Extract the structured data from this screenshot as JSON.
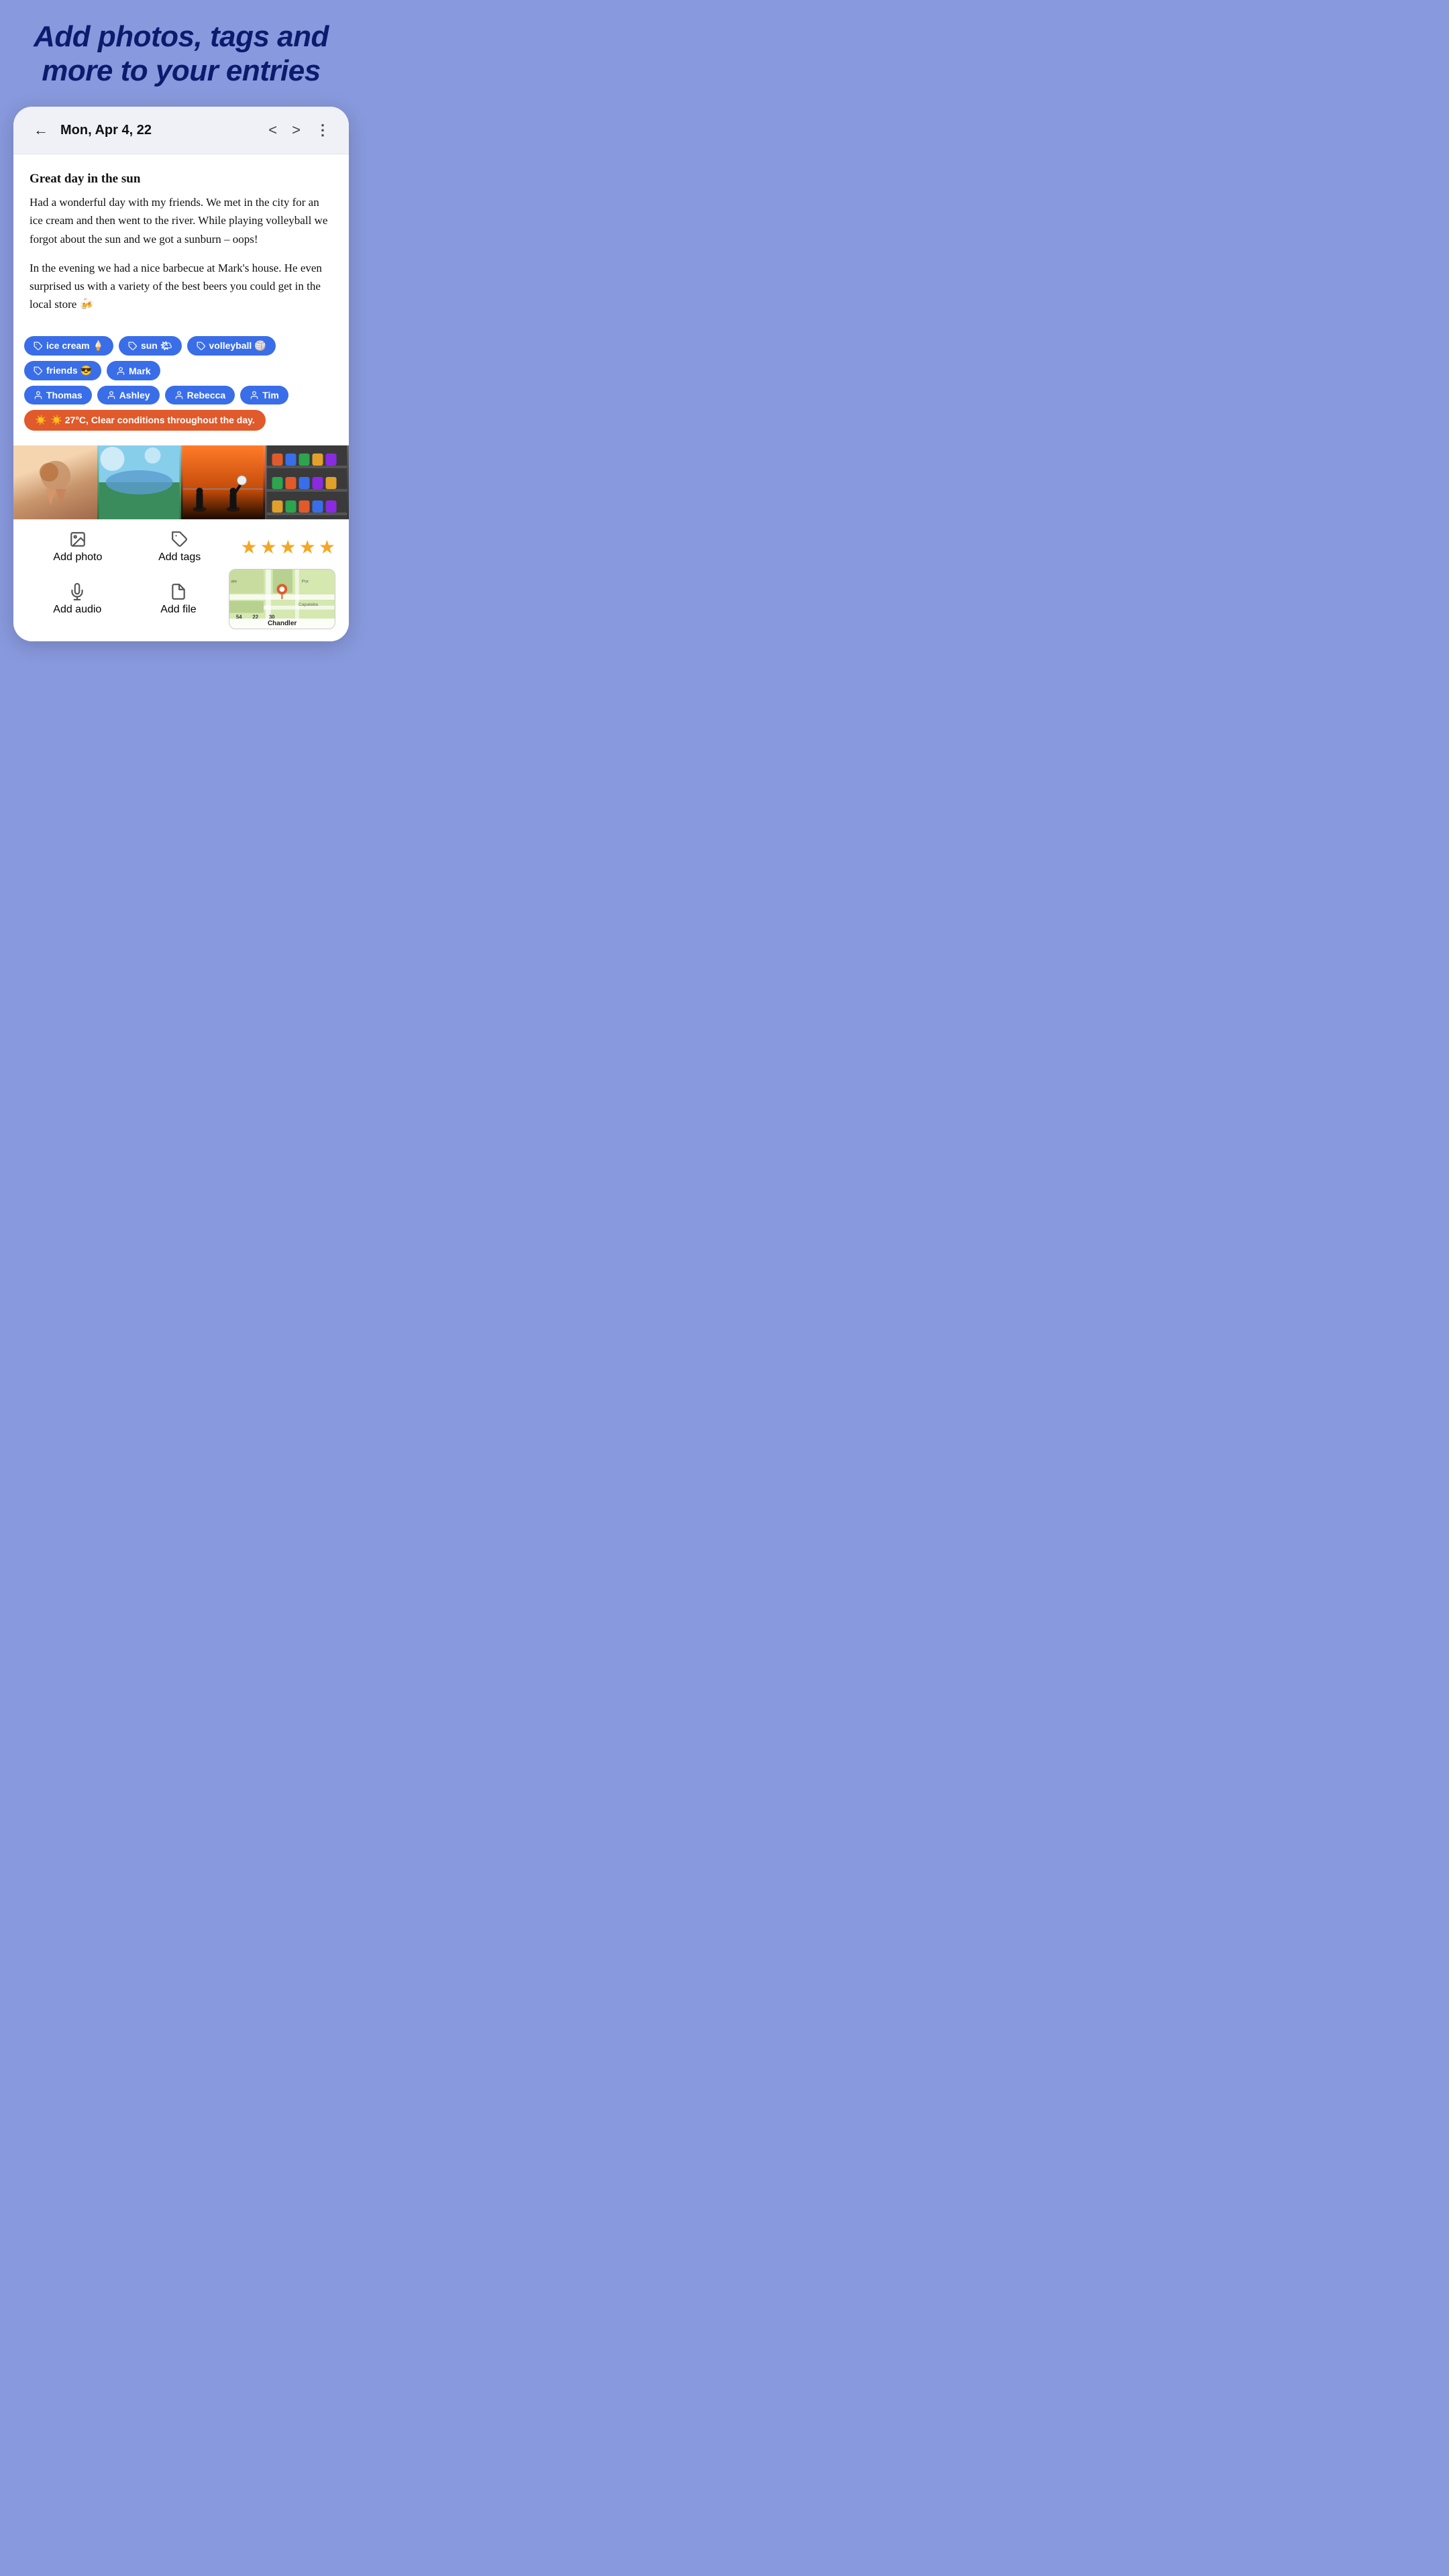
{
  "hero": {
    "title": "Add photos, tags and more to your entries"
  },
  "header": {
    "back_label": "←",
    "date": "Mon, Apr 4, 22",
    "nav_prev": "<",
    "nav_next": ">",
    "more": "⋮"
  },
  "entry": {
    "title": "Great day in the sun",
    "paragraph1": "Had a wonderful day with my friends. We met in the city for an ice cream and then went to the river. While playing volleyball we forgot about the sun and we got a sunburn – oops!",
    "paragraph2": "In the evening we had a nice barbecue at Mark's house. He even surprised us with a variety of the best beers you could get in the local store 🍻"
  },
  "tags": {
    "items": [
      {
        "label": "ice cream 🍦",
        "type": "tag"
      },
      {
        "label": "sun 🌤",
        "type": "tag"
      },
      {
        "label": "volleyball 🏐",
        "type": "tag"
      },
      {
        "label": "friends 😎",
        "type": "tag"
      },
      {
        "label": "Mark",
        "type": "person"
      },
      {
        "label": "Thomas",
        "type": "person"
      },
      {
        "label": "Ashley",
        "type": "person"
      },
      {
        "label": "Rebecca",
        "type": "person"
      },
      {
        "label": "Tim",
        "type": "person"
      }
    ],
    "weather": "☀️ 27°C, Clear conditions throughout the day."
  },
  "photos": [
    {
      "emoji": "🍦",
      "alt": "ice cream photo"
    },
    {
      "emoji": "🌊",
      "alt": "river photo"
    },
    {
      "emoji": "🏐",
      "alt": "volleyball photo"
    },
    {
      "emoji": "🍺",
      "alt": "beers photo"
    }
  ],
  "toolbar": {
    "row1": [
      {
        "icon": "photo",
        "label": "Add photo"
      },
      {
        "icon": "tag",
        "label": "Add tags"
      }
    ],
    "stars": [
      "★",
      "★",
      "★",
      "★",
      "★"
    ],
    "row2": [
      {
        "icon": "mic",
        "label": "Add audio"
      },
      {
        "icon": "file",
        "label": "Add file"
      }
    ],
    "map": {
      "city": "Chandler",
      "pin": "📍"
    }
  }
}
